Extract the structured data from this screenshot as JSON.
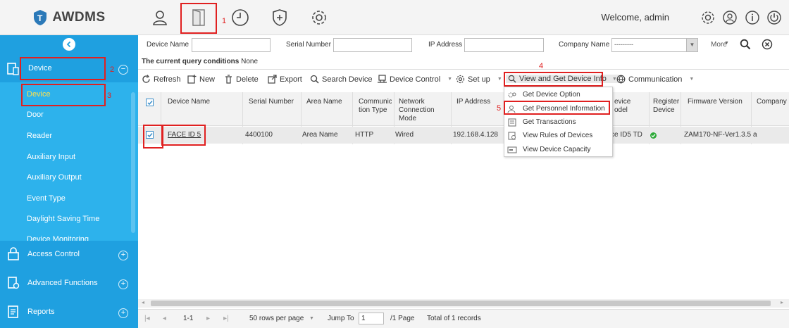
{
  "app": {
    "name": "AWDMS",
    "welcome": "Welcome, admin"
  },
  "topnav": {
    "annotation_1": "1"
  },
  "sidebar": {
    "device_label": "Device",
    "annotation_2": "2",
    "annotation_3": "3",
    "sub_items": [
      "Device",
      "Door",
      "Reader",
      "Auxiliary Input",
      "Auxiliary Output",
      "Event Type",
      "Daylight Saving Time",
      "Device Monitoring"
    ],
    "sections": [
      "Access Control",
      "Advanced Functions",
      "Reports"
    ]
  },
  "query": {
    "device_name_label": "Device Name",
    "serial_label": "Serial Number",
    "ip_label": "IP Address",
    "company_label": "Company Name",
    "company_value": "---------",
    "more_label": "More",
    "conditions_label": "The current query conditions",
    "conditions_value": "None"
  },
  "toolbar": {
    "refresh": "Refresh",
    "new": "New",
    "delete": "Delete",
    "export": "Export",
    "search_device": "Search Device",
    "device_control": "Device Control",
    "setup": "Set up",
    "view_get": "View and Get Device Info",
    "communication": "Communication",
    "annotation_4": "4"
  },
  "menu": {
    "items": [
      "Get Device Option",
      "Get Personnel Information",
      "Get Transactions",
      "View Rules of Devices",
      "View Device Capacity"
    ],
    "annotation_5": "5"
  },
  "grid": {
    "headers": [
      "Device Name",
      "Serial Number",
      "Area Name",
      "Communica\ntion Type",
      "Network\nConnection\nMode",
      "IP Address",
      "evice\nodel",
      "Register\nDevice",
      "Firmware Version",
      "Company"
    ],
    "row": [
      "FACE ID 5",
      "4400100",
      "Area Name",
      "HTTP",
      "Wired",
      "192.168.4.128",
      "ce ID5 TD",
      "",
      "ZAM170-NF-Ver1.3.5",
      "a"
    ]
  },
  "pager": {
    "range": "1-1",
    "rows_per_page": "50 rows per page",
    "jump_to": "Jump To",
    "page_value": "1",
    "page_total": "/1 Page",
    "total": "Total of 1 records"
  },
  "colors": {
    "sidebar": "#1fa0e0",
    "subpanel": "#2db2ec",
    "highlight": "#e02020",
    "selected_text": "#ffe14d"
  }
}
